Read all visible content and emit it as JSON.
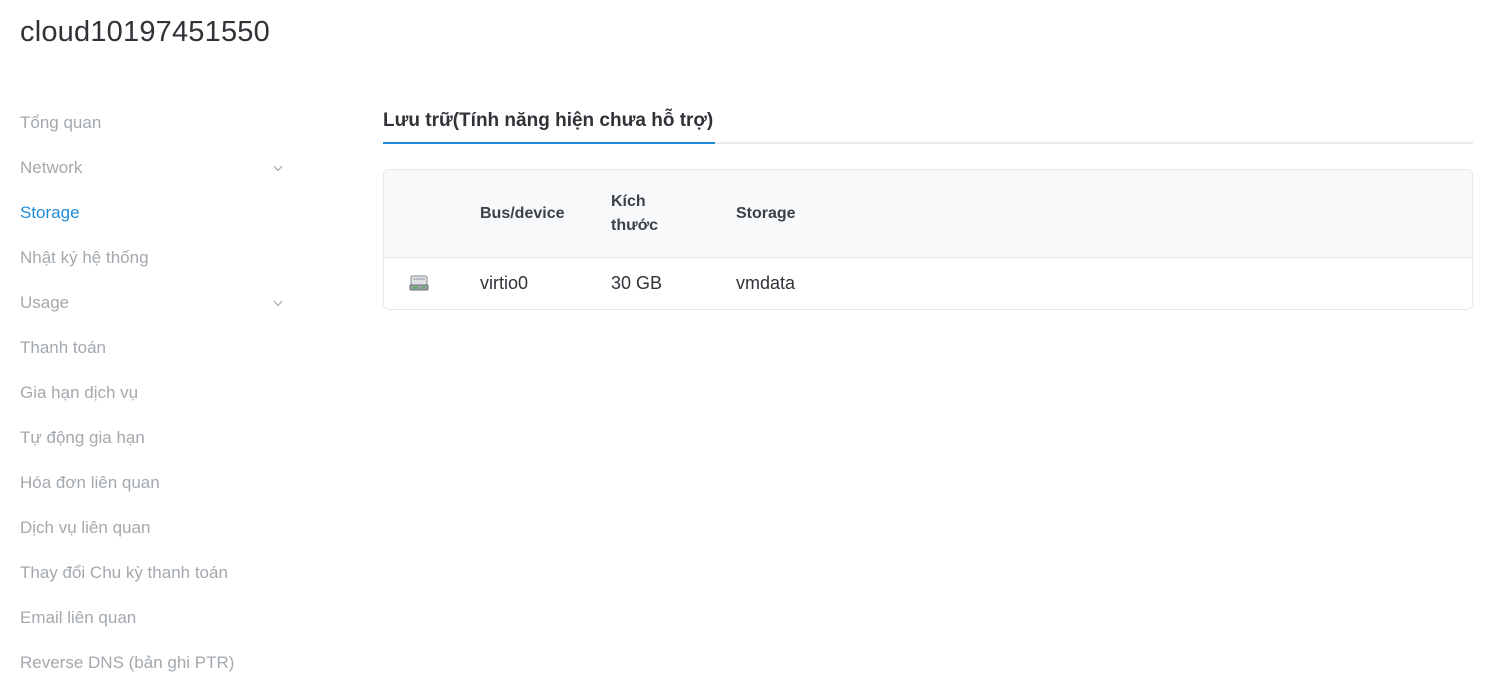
{
  "header": {
    "title": "cloud10197451550"
  },
  "sidebar": {
    "items": [
      {
        "label": "Tổng quan"
      },
      {
        "label": "Network",
        "has_submenu": true
      },
      {
        "label": "Storage",
        "active": true
      },
      {
        "label": "Nhật ký hệ thống"
      },
      {
        "label": "Usage",
        "has_submenu": true
      },
      {
        "label": "Thanh toán"
      },
      {
        "label": "Gia hạn dịch vụ"
      },
      {
        "label": "Tự động gia hạn"
      },
      {
        "label": "Hóa đơn liên quan"
      },
      {
        "label": "Dịch vụ liên quan"
      },
      {
        "label": "Thay đổi Chu kỳ thanh toán"
      },
      {
        "label": "Email liên quan"
      },
      {
        "label": "Reverse DNS (bản ghi PTR)"
      }
    ],
    "submenu_icon": "chevron-down-icon"
  },
  "main": {
    "tab": {
      "label": "Lưu trữ(Tính năng hiện chưa hỗ trợ)"
    },
    "table": {
      "columns": [
        "Bus/device",
        "Kích thước",
        "Storage"
      ],
      "rows": [
        {
          "icon": "hard-drive-icon",
          "bus": "virtio0",
          "size": "30 GB",
          "storage": "vmdata"
        }
      ]
    }
  },
  "colors": {
    "accent": "#1e8bd8",
    "muted_text": "#a3a9ae",
    "header_bg": "#f8f9fa",
    "border": "#e6e9ec"
  }
}
